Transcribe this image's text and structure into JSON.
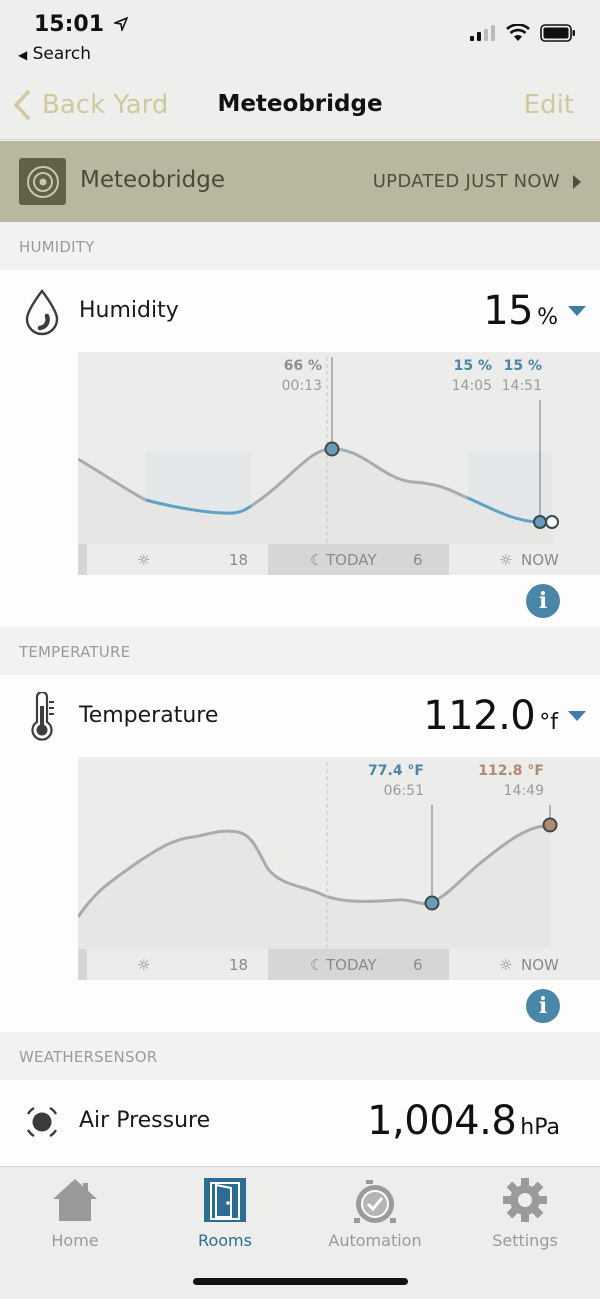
{
  "status": {
    "time": "15:01",
    "back_app": "Search"
  },
  "nav": {
    "back_label": "Back Yard",
    "title": "Meteobridge",
    "edit_label": "Edit"
  },
  "device": {
    "name": "Meteobridge",
    "updated": "UPDATED JUST NOW"
  },
  "colors": {
    "accent": "#3d7ea3",
    "olive": "#b9b79f",
    "nav_tint": "#cfca9c",
    "info": "#4a86a6"
  },
  "humidity": {
    "section": "HUMIDITY",
    "label": "Humidity",
    "value": "15",
    "unit": "%",
    "icon": "droplet-icon",
    "marker_a": {
      "value": "66 %",
      "time": "00:13"
    },
    "marker_b": {
      "value": "15 %",
      "time": "14:05"
    },
    "marker_c": {
      "value": "15 %",
      "time": "14:51"
    },
    "timeline": {
      "day_num": "18",
      "today": "TODAY",
      "night_num": "6",
      "now": "NOW"
    }
  },
  "temperature": {
    "section": "TEMPERATURE",
    "label": "Temperature",
    "value": "112.0",
    "unit": "°f",
    "icon": "thermometer-icon",
    "marker_a": {
      "value": "77.4 °F",
      "time": "06:51"
    },
    "marker_b": {
      "value": "112.8 °F",
      "time": "14:49"
    },
    "timeline": {
      "day_num": "18",
      "today": "TODAY",
      "night_num": "6",
      "now": "NOW"
    }
  },
  "weathersensor": {
    "section": "WEATHERSENSOR",
    "label": "Air Pressure",
    "value": "1,004.8",
    "unit": "hPa",
    "icon": "pressure-icon"
  },
  "tabs": [
    {
      "label": "Home",
      "icon": "house-icon",
      "active": false
    },
    {
      "label": "Rooms",
      "icon": "door-icon",
      "active": true
    },
    {
      "label": "Automation",
      "icon": "alarm-clock-icon",
      "active": false
    },
    {
      "label": "Settings",
      "icon": "gear-icon",
      "active": false
    }
  ]
}
